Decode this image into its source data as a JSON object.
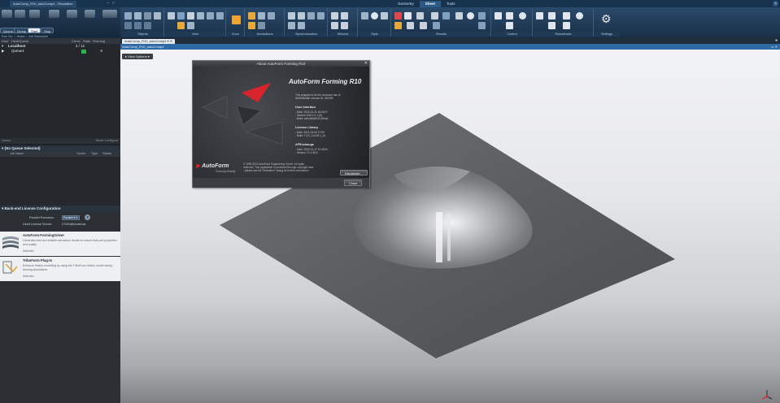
{
  "titlebar": {
    "file_tab": "AutoComp_R10_autoComp4 - Simulation",
    "ribbon_tabs": [
      "Geometry",
      "Sheet",
      "Tools"
    ],
    "active_ribbon_tab": "Sheet",
    "help": "?"
  },
  "left_toolbar": {
    "buttons": [
      "Queue",
      "Group",
      "Start",
      "Stop"
    ],
    "run_on": "Run On:",
    "run_on_options": [
      "Hosts",
      "Job Scheduler"
    ]
  },
  "ribbon": {
    "groups": [
      "Objects",
      "View",
      "Zone",
      "Annotations",
      "Synchronization",
      "Window",
      "Style",
      "Results",
      "Control",
      "Robustness",
      "Settings"
    ]
  },
  "queue_panel": {
    "columns": [
      "Host",
      "Host/Queue",
      "Cores",
      "State",
      "Running"
    ],
    "rows": [
      {
        "name": "Localhost",
        "cores": "3 / 12",
        "state": "",
        "running": ""
      },
      {
        "name": "Queue1",
        "cores": "",
        "state": "",
        "running": "0"
      }
    ],
    "footer_left": "Queue",
    "footer_right": "Reset  Configure"
  },
  "job_panel": {
    "title": "(No Queue Selected)",
    "columns": [
      "Job Name",
      "Owner",
      "Type",
      "Status"
    ]
  },
  "backend": {
    "title": "Back-end License Configuration",
    "parallel_label": "Parallel Execution",
    "parallel_value": "Parallel 8",
    "license_label": "Used License Server:",
    "license_value": "27000@localhost",
    "help": "?",
    "solvers": [
      {
        "title": "AutoForm-FormingSolver",
        "desc": "Generates fast and reliable simulation results to ensure that part properties and quality",
        "status": "Selected"
      },
      {
        "title": "TriboForm Plug-In",
        "desc": "Enhance friction modelling by using the TriboForm friction model during forming simulations",
        "status": "Selected"
      }
    ]
  },
  "document": {
    "tab": "AutoComp_R10_autoComp4",
    "view_title": "AutoComp_R10_autoComp4",
    "view_options": "View Options"
  },
  "about": {
    "caption": "About AutoForm Forming R10",
    "close_x": "✕",
    "product": "AutoForm Forming R10",
    "intro": [
      "This program is for the exclusive use of",
      "AM4xStealth License ID: 000309"
    ],
    "sections": [
      {
        "heading": "User Interface",
        "lines": [
          "- Date: 2022-01-21 15:06:07",
          "- Version: R10.0.1.1 (8)",
          "- Build: ca91a9d81b3 (Wine)"
        ]
      },
      {
        "heading": "License Library",
        "lines": [
          "- Date: 2021-03-09 17:55",
          "- Build: 7.0.0_114.06.1_x4"
        ]
      },
      {
        "heading": "AFExchange",
        "lines": [
          "- Date: 2022-01-17 22:48:20",
          "- Version: 21.4.38.0"
        ]
      }
    ],
    "copyright": [
      "© 1995-2022 AutoForm Engineering GmbH. All rights",
      "reserved. This application is protected through copyright laws",
      "- please see the 'Disclaimer' dialog for further information."
    ],
    "logo": "AutoForm",
    "tagline": "Forming Reality",
    "disclaimer_button": "Disclaimer...",
    "close_button": "Close"
  },
  "colors": {
    "titlebar": "#17324d",
    "ribbon": "#2a4a6c",
    "view_title": "#2f6aa6",
    "accent_red": "#d8242c"
  }
}
